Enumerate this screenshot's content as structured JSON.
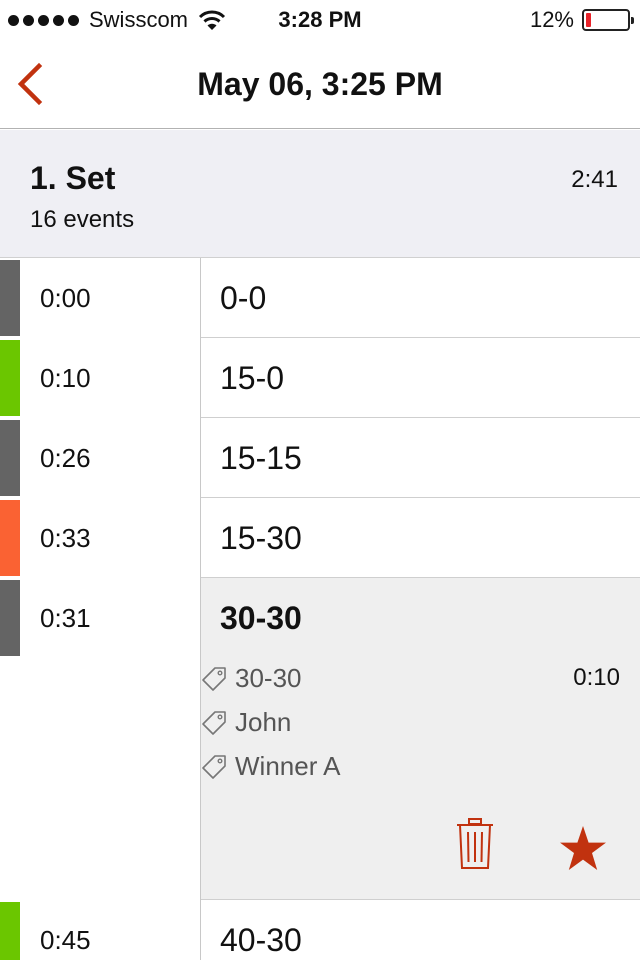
{
  "status_bar": {
    "carrier": "Swisscom",
    "time": "3:28 PM",
    "battery": "12%",
    "battery_level": 0.12,
    "battery_color": "#e8232a",
    "signal_icon": "signal-dots-icon",
    "wifi_icon": "wifi-icon"
  },
  "nav": {
    "title": "May 06, 3:25 PM",
    "back_icon": "chevron-left-icon",
    "accent_color": "#c1320f"
  },
  "set": {
    "title": "1. Set",
    "subtitle": "16 events",
    "duration": "2:41"
  },
  "events": [
    {
      "time": "0:00",
      "score": "0-0",
      "color": "#646464"
    },
    {
      "time": "0:10",
      "score": "15-0",
      "color": "#6bc600"
    },
    {
      "time": "0:26",
      "score": "15-15",
      "color": "#646464"
    },
    {
      "time": "0:33",
      "score": "15-30",
      "color": "#fa6233"
    },
    {
      "time": "0:31",
      "score": "30-30",
      "color": "#646464",
      "expanded": true
    },
    {
      "time": "0:45",
      "score": "40-30",
      "color": "#6bc600"
    }
  ],
  "expanded_detail": {
    "tags": [
      "30-30",
      "John",
      "Winner A"
    ],
    "tag_icon": "tag-icon",
    "duration": "0:10",
    "delete_icon": "trash-icon",
    "favorite_icon": "star-icon"
  }
}
